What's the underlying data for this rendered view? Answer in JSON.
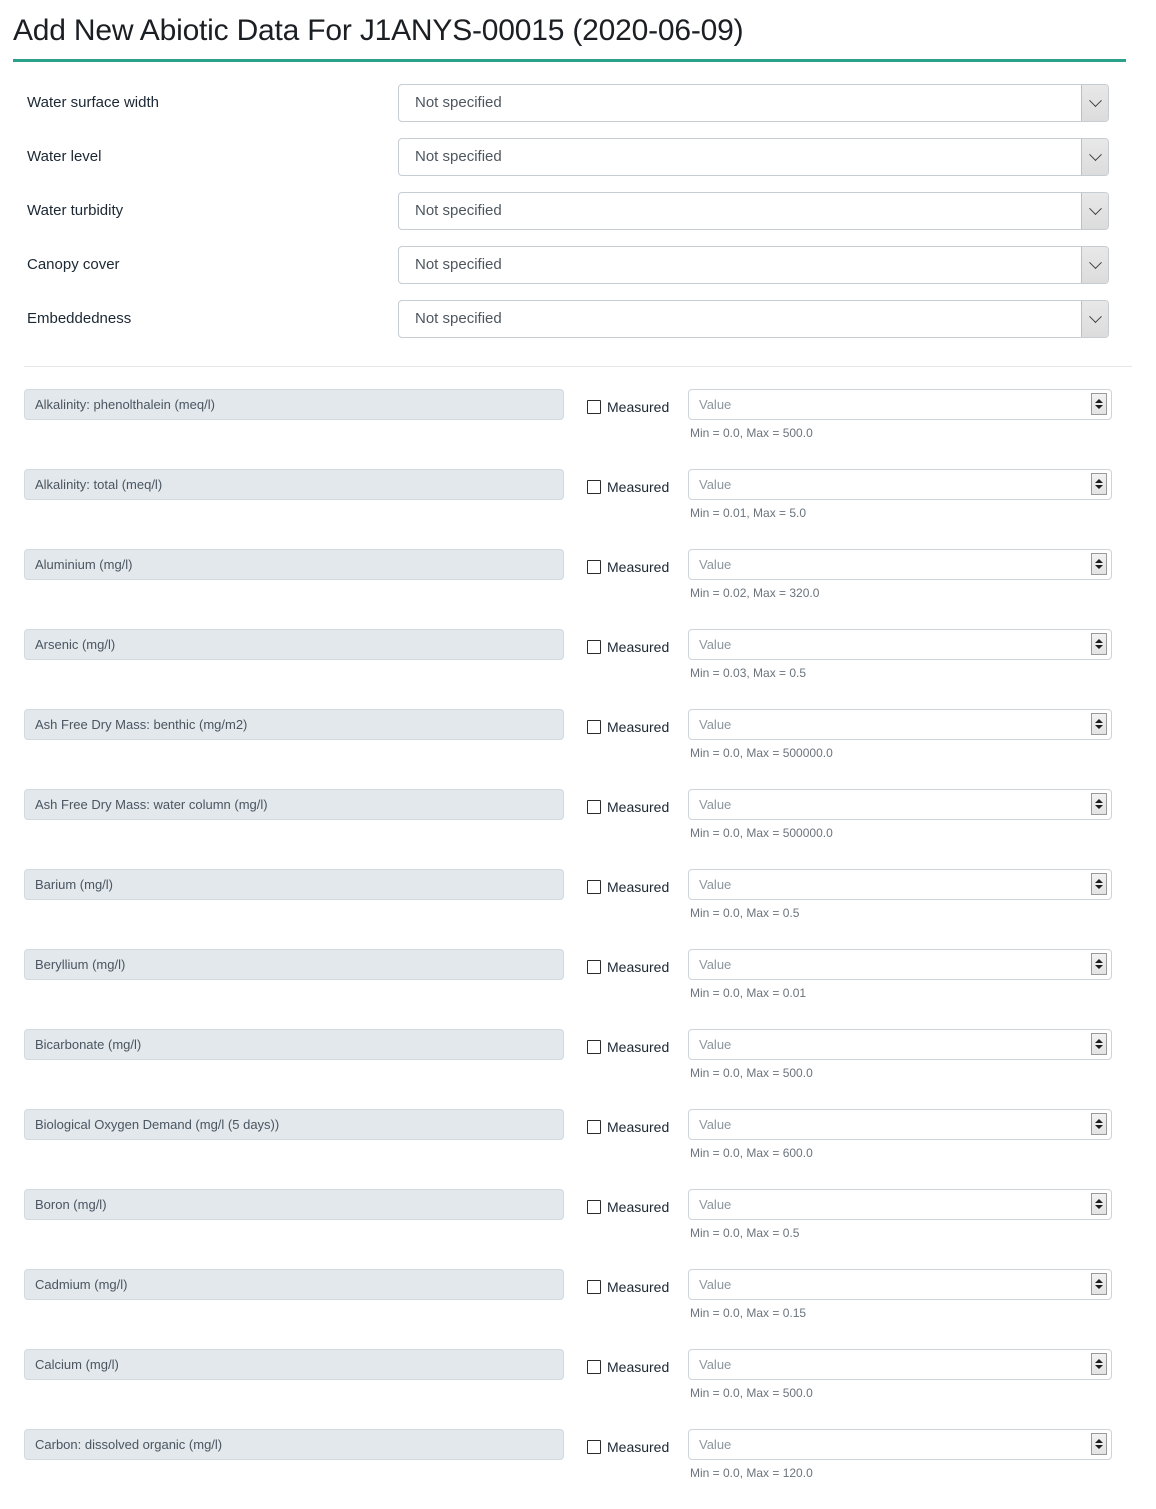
{
  "header": {
    "title": "Add New Abiotic Data For J1ANYS-00015 (2020-06-09)",
    "accent_color": "#2ba08a"
  },
  "habitat_selects": [
    {
      "label": "Water surface width",
      "value": "Not specified",
      "icon": "chevron-down-icon"
    },
    {
      "label": "Water level",
      "value": "Not specified",
      "icon": "chevron-down-icon"
    },
    {
      "label": "Water turbidity",
      "value": "Not specified",
      "icon": "chevron-down-icon"
    },
    {
      "label": "Canopy cover",
      "value": "Not specified",
      "icon": "chevron-down-icon"
    },
    {
      "label": "Embeddedness",
      "value": "Not specified",
      "icon": "chevron-down-icon"
    }
  ],
  "common": {
    "measured_label": "Measured",
    "value_placeholder": "Value",
    "spinner_icon": "spinner-stepper-icon",
    "checkbox_icon": "checkbox-unchecked-icon"
  },
  "parameters": [
    {
      "name": "Alkalinity: phenolthalein (meq/l)",
      "measured": false,
      "value": "",
      "range": "Min = 0.0, Max = 500.0",
      "min": "0.0",
      "max": "500.0"
    },
    {
      "name": "Alkalinity: total (meq/l)",
      "measured": false,
      "value": "",
      "range": "Min = 0.01, Max = 5.0",
      "min": "0.01",
      "max": "5.0"
    },
    {
      "name": "Aluminium (mg/l)",
      "measured": false,
      "value": "",
      "range": "Min = 0.02, Max = 320.0",
      "min": "0.02",
      "max": "320.0"
    },
    {
      "name": "Arsenic (mg/l)",
      "measured": false,
      "value": "",
      "range": "Min = 0.03, Max = 0.5",
      "min": "0.03",
      "max": "0.5"
    },
    {
      "name": "Ash Free Dry Mass: benthic (mg/m2)",
      "measured": false,
      "value": "",
      "range": "Min = 0.0, Max = 500000.0",
      "min": "0.0",
      "max": "500000.0"
    },
    {
      "name": "Ash Free Dry Mass: water column (mg/l)",
      "measured": false,
      "value": "",
      "range": "Min = 0.0, Max = 500000.0",
      "min": "0.0",
      "max": "500000.0"
    },
    {
      "name": "Barium (mg/l)",
      "measured": false,
      "value": "",
      "range": "Min = 0.0, Max = 0.5",
      "min": "0.0",
      "max": "0.5"
    },
    {
      "name": "Beryllium (mg/l)",
      "measured": false,
      "value": "",
      "range": "Min = 0.0, Max = 0.01",
      "min": "0.0",
      "max": "0.01"
    },
    {
      "name": "Bicarbonate (mg/l)",
      "measured": false,
      "value": "",
      "range": "Min = 0.0, Max = 500.0",
      "min": "0.0",
      "max": "500.0"
    },
    {
      "name": "Biological Oxygen Demand (mg/l (5 days))",
      "measured": false,
      "value": "",
      "range": "Min = 0.0, Max = 600.0",
      "min": "0.0",
      "max": "600.0"
    },
    {
      "name": "Boron (mg/l)",
      "measured": false,
      "value": "",
      "range": "Min = 0.0, Max = 0.5",
      "min": "0.0",
      "max": "0.5"
    },
    {
      "name": "Cadmium (mg/l)",
      "measured": false,
      "value": "",
      "range": "Min = 0.0, Max = 0.15",
      "min": "0.0",
      "max": "0.15"
    },
    {
      "name": "Calcium (mg/l)",
      "measured": false,
      "value": "",
      "range": "Min = 0.0, Max = 500.0",
      "min": "0.0",
      "max": "500.0"
    },
    {
      "name": "Carbon: dissolved organic (mg/l)",
      "measured": false,
      "value": "",
      "range": "Min = 0.0, Max = 120.0",
      "min": "0.0",
      "max": "120.0"
    }
  ]
}
